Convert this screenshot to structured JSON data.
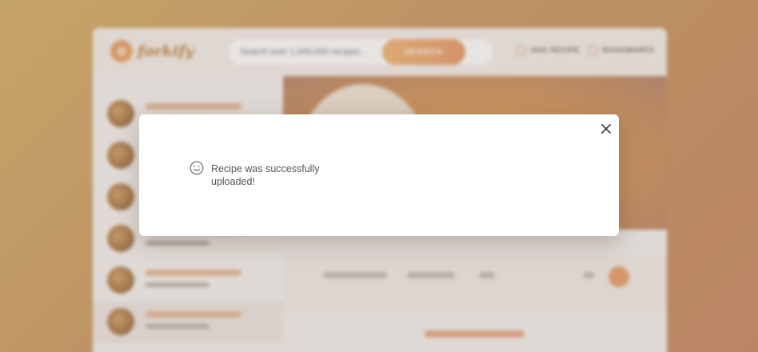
{
  "app": {
    "logo_text": "forkify",
    "search": {
      "placeholder": "Search over 1,000,000 recipes...",
      "button_label": "SEARCH"
    },
    "nav": {
      "add_recipe": "ADD RECIPE",
      "bookmarks": "BOOKMARKS"
    }
  },
  "modal": {
    "message": "Recipe was successfully uploaded!",
    "icon": "smile-icon",
    "close_icon": "close-icon"
  },
  "colors": {
    "accent": "#e99a6b",
    "modal_bg": "#ffffff",
    "text": "#555555"
  }
}
